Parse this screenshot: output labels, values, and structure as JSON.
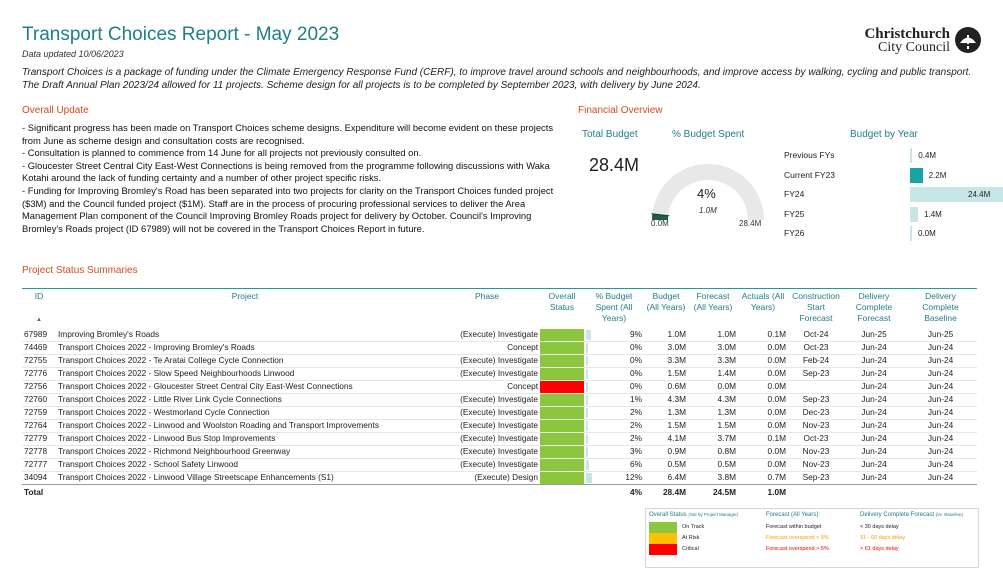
{
  "header": {
    "title": "Transport Choices Report - May 2023",
    "updated": "Data updated 10/06/2023",
    "intro_1": "Transport Choices is a package of funding under the Climate Emergency Response Fund (CERF), to improve travel around schools and neighbourhoods, and improve access by walking, cycling and public transport.",
    "intro_2": "The Draft Annual Plan 2023/24 allowed for 11 projects.  Scheme design for all projects is to be completed by September 2023, with delivery by June 2024."
  },
  "logo": {
    "line1": "Christchurch",
    "line2": "City Council",
    "icon": "council-emblem-icon"
  },
  "overall": {
    "heading": "Overall Update",
    "paragraphs": [
      "- Significant progress has been made on Transport Choices scheme designs.  Expenditure will become evident on these projects from June as scheme design and consultation costs are recognised.",
      "- Consultation is planned to commence from 14 June for all projects not previously consulted on.",
      "- Gloucester Street Central City East-West Connections is being removed from the programme following discussions with Waka Kotahi around the lack of funding certainty and a number of other project specific risks.",
      "- Funding for Improving Bromley's Road has been separated into two projects for clarity on the Transport Choices funded project ($3M) and the Council funded project ($1M).  Staff are in the process of procuring professional services to deliver the Area Management Plan component of the Council Improving Bromley Roads project for delivery by October. Council's Improving Bromley's Roads project (ID 67989) will not be covered in the Transport Choices Report in future."
    ]
  },
  "financial": {
    "heading": "Financial Overview",
    "total_budget_label": "Total Budget",
    "total_budget_value": "28.4M",
    "pct_spent_label": "% Budget Spent",
    "gauge": {
      "value_label": "4%",
      "target_label": "1.0M",
      "min_label": "0.0M",
      "max_label": "28.4M",
      "fraction": 0.035,
      "target_fraction": 0.035
    },
    "budget_by_year_label": "Budget by Year"
  },
  "chart_data": {
    "type": "bar",
    "title": "Budget by Year",
    "categories": [
      "Previous FYs",
      "Current FY23",
      "FY24",
      "FY25",
      "FY26"
    ],
    "values": [
      0.4,
      2.2,
      24.4,
      1.4,
      0.0
    ],
    "value_labels": [
      "0.4M",
      "2.2M",
      "24.4M",
      "1.4M",
      "0.0M"
    ],
    "highlight_index": 1,
    "colors": {
      "normal": "#c7e6e8",
      "highlight": "#1aa3a3"
    },
    "xlim": [
      0,
      24.4
    ]
  },
  "projects": {
    "heading": "Project Status Summaries",
    "columns": {
      "id": "ID",
      "project": "Project",
      "phase": "Phase",
      "status": "Overall Status",
      "pct": "% Budget Spent (All Years)",
      "budget": "Budget (All Years)",
      "forecast": "Forecast (All Years)",
      "actuals": "Actuals (All Years)",
      "cstart": "Construction Start Forecast",
      "dforecast": "Delivery Complete Forecast",
      "dbaseline": "Delivery Complete Baseline"
    },
    "status_colors": {
      "on_track": "#8cc63f",
      "critical": "#ff0000"
    },
    "rows": [
      {
        "id": "67989",
        "project": "Improving Bromley's Roads",
        "phase": "(Execute) Investigate",
        "status": "on_track",
        "pct": "9%",
        "pct_num": 9,
        "budget": "1.0M",
        "forecast": "1.0M",
        "actuals": "0.1M",
        "cstart": "Oct-24",
        "dforecast": "Jun-25",
        "dbaseline": "Jun-25"
      },
      {
        "id": "74469",
        "project": "Transport Choices 2022 - Improving Bromley's Roads",
        "phase": "Concept",
        "status": "on_track",
        "pct": "0%",
        "pct_num": 0,
        "budget": "3.0M",
        "forecast": "3.0M",
        "actuals": "0.0M",
        "cstart": "Oct-23",
        "dforecast": "Jun-24",
        "dbaseline": "Jun-24"
      },
      {
        "id": "72755",
        "project": "Transport Choices 2022 - Te Aratai College Cycle Connection",
        "phase": "(Execute) Investigate",
        "status": "on_track",
        "pct": "0%",
        "pct_num": 0,
        "budget": "3.3M",
        "forecast": "3.3M",
        "actuals": "0.0M",
        "cstart": "Feb-24",
        "dforecast": "Jun-24",
        "dbaseline": "Jun-24"
      },
      {
        "id": "72776",
        "project": "Transport Choices 2022 - Slow Speed Neighbourhoods Linwood",
        "phase": "(Execute) Investigate",
        "status": "on_track",
        "pct": "0%",
        "pct_num": 0,
        "budget": "1.5M",
        "forecast": "1.4M",
        "actuals": "0.0M",
        "cstart": "Sep-23",
        "dforecast": "Jun-24",
        "dbaseline": "Jun-24"
      },
      {
        "id": "72756",
        "project": "Transport Choices 2022 - Gloucester Street Central City East-West Connections",
        "phase": "Concept",
        "status": "critical",
        "pct": "0%",
        "pct_num": 0,
        "budget": "0.6M",
        "forecast": "0.0M",
        "actuals": "0.0M",
        "cstart": "",
        "dforecast": "Jun-24",
        "dbaseline": "Jun-24"
      },
      {
        "id": "72760",
        "project": "Transport Choices 2022 - Little River Link Cycle Connections",
        "phase": "(Execute) Investigate",
        "status": "on_track",
        "pct": "1%",
        "pct_num": 1,
        "budget": "4.3M",
        "forecast": "4.3M",
        "actuals": "0.0M",
        "cstart": "Sep-23",
        "dforecast": "Jun-24",
        "dbaseline": "Jun-24"
      },
      {
        "id": "72759",
        "project": "Transport Choices 2022 - Westmorland Cycle Connection",
        "phase": "(Execute) Investigate",
        "status": "on_track",
        "pct": "2%",
        "pct_num": 2,
        "budget": "1.3M",
        "forecast": "1.3M",
        "actuals": "0.0M",
        "cstart": "Dec-23",
        "dforecast": "Jun-24",
        "dbaseline": "Jun-24"
      },
      {
        "id": "72764",
        "project": "Transport Choices 2022 - Linwood and Woolston Roading and Transport Improvements",
        "phase": "(Execute) Investigate",
        "status": "on_track",
        "pct": "2%",
        "pct_num": 2,
        "budget": "1.5M",
        "forecast": "1.5M",
        "actuals": "0.0M",
        "cstart": "Nov-23",
        "dforecast": "Jun-24",
        "dbaseline": "Jun-24"
      },
      {
        "id": "72779",
        "project": "Transport Choices 2022 - Linwood Bus Stop Improvements",
        "phase": "(Execute) Investigate",
        "status": "on_track",
        "pct": "2%",
        "pct_num": 2,
        "budget": "4.1M",
        "forecast": "3.7M",
        "actuals": "0.1M",
        "cstart": "Oct-23",
        "dforecast": "Jun-24",
        "dbaseline": "Jun-24"
      },
      {
        "id": "72778",
        "project": "Transport Choices 2022 - Richmond Neighbourhood Greenway",
        "phase": "(Execute) Investigate",
        "status": "on_track",
        "pct": "3%",
        "pct_num": 3,
        "budget": "0.9M",
        "forecast": "0.8M",
        "actuals": "0.0M",
        "cstart": "Nov-23",
        "dforecast": "Jun-24",
        "dbaseline": "Jun-24"
      },
      {
        "id": "72777",
        "project": "Transport Choices 2022 - School Safety Linwood",
        "phase": "(Execute) Investigate",
        "status": "on_track",
        "pct": "6%",
        "pct_num": 6,
        "budget": "0.5M",
        "forecast": "0.5M",
        "actuals": "0.0M",
        "cstart": "Nov-23",
        "dforecast": "Jun-24",
        "dbaseline": "Jun-24"
      },
      {
        "id": "34094",
        "project": "Transport Choices 2022 - Linwood Village Streetscape Enhancements (S1)",
        "phase": "(Execute) Design",
        "status": "on_track",
        "pct": "12%",
        "pct_num": 12,
        "budget": "6.4M",
        "forecast": "3.8M",
        "actuals": "0.7M",
        "cstart": "Sep-23",
        "dforecast": "Jun-24",
        "dbaseline": "Jun-24"
      }
    ],
    "total": {
      "label": "Total",
      "pct": "4%",
      "budget": "28.4M",
      "forecast": "24.5M",
      "actuals": "1.0M"
    }
  },
  "legend": {
    "status_title": "Overall Status",
    "status_note": "(Set by Project Manager)",
    "forecast_title": "Forecast (All Years):",
    "delivery_title": "Delivery Complete Forecast",
    "delivery_note": "(vs. Baseline)",
    "items": [
      {
        "swatch": "#8cc63f",
        "status": "On Track",
        "forecast": "Forecast within budget",
        "forecast_color": "#222222",
        "delivery": "< 30 days delay",
        "delivery_color": "#222222"
      },
      {
        "swatch": "#ffc000",
        "status": "At Risk",
        "forecast": "Forecast overspend < 5%",
        "forecast_color": "#f0a000",
        "delivery": "31 - 60 days delay",
        "delivery_color": "#f0a000"
      },
      {
        "swatch": "#ff0000",
        "status": "Critical",
        "forecast": "Forecast overspend > 5%",
        "forecast_color": "#ff0000",
        "delivery": "> 61 days delay",
        "delivery_color": "#ff0000"
      }
    ]
  }
}
